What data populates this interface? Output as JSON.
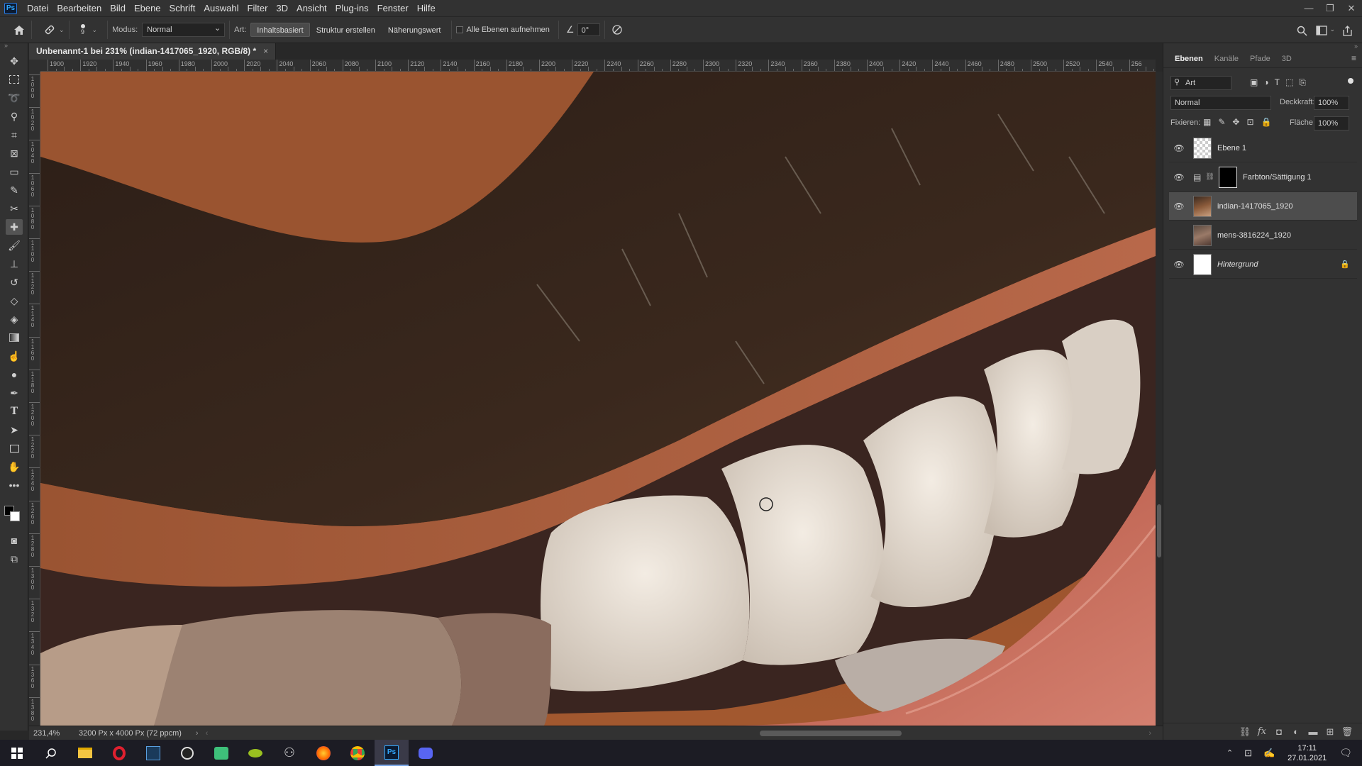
{
  "app": {
    "logo": "Ps",
    "menu": [
      "Datei",
      "Bearbeiten",
      "Bild",
      "Ebene",
      "Schrift",
      "Auswahl",
      "Filter",
      "3D",
      "Ansicht",
      "Plug-ins",
      "Fenster",
      "Hilfe"
    ],
    "window_controls": [
      "—",
      "❐",
      "✕"
    ]
  },
  "options": {
    "brush_size": "9",
    "mode_label": "Modus:",
    "mode_value": "Normal",
    "type_label": "Art:",
    "type_buttons": [
      "Inhaltsbasiert",
      "Struktur erstellen",
      "Näherungswert"
    ],
    "sample_all_label": "Alle Ebenen aufnehmen",
    "angle_value": "0°"
  },
  "document": {
    "tab_title": "Unbenannt-1 bei 231% (indian-1417065_1920, RGB/8) *",
    "close": "×",
    "ruler_labels": [
      "1900",
      "1920",
      "1940",
      "1960",
      "1980",
      "2000",
      "2020",
      "2040",
      "2060",
      "2080",
      "2100",
      "2120",
      "2140",
      "2160",
      "2180",
      "2200",
      "2220",
      "2240",
      "2260",
      "2280",
      "2300",
      "2320",
      "2340",
      "2360",
      "2380",
      "2400",
      "2420",
      "2440",
      "2460",
      "2480",
      "2500",
      "2520",
      "2540",
      "256"
    ],
    "vertical_ruler_labels": [
      "1000",
      "1020",
      "1040",
      "1060",
      "1080",
      "1100",
      "1120",
      "1140",
      "1160",
      "1180",
      "1200",
      "1220",
      "1240",
      "1260",
      "1280",
      "1300",
      "1320",
      "1340",
      "1360",
      "1380"
    ]
  },
  "status": {
    "zoom": "231,4%",
    "doc_size": "3200 Px x 4000 Px (72 ppcm)"
  },
  "panel": {
    "tabs": [
      "Ebenen",
      "Kanäle",
      "Pfade",
      "3D"
    ],
    "filter_value": "Art",
    "blend_mode": "Normal",
    "opacity_label": "Deckkraft:",
    "opacity_value": "100%",
    "lock_label": "Fixieren:",
    "fill_label": "Fläche:",
    "fill_value": "100%",
    "layers": [
      {
        "name": "Ebene 1",
        "visible": true,
        "selected": false,
        "thumb": "transparent"
      },
      {
        "name": "Farbton/Sättigung 1",
        "visible": true,
        "selected": false,
        "thumb": "adjustment"
      },
      {
        "name": "indian-1417065_1920",
        "visible": true,
        "selected": true,
        "thumb": "photo"
      },
      {
        "name": "mens-3816224_1920",
        "visible": false,
        "selected": false,
        "thumb": "photo2"
      },
      {
        "name": "Hintergrund",
        "visible": true,
        "selected": false,
        "thumb": "white",
        "locked": true
      }
    ]
  },
  "taskbar": {
    "time": "17:11",
    "date": "27.01.2021"
  },
  "colors": {
    "accent": "#31a8ff",
    "panel_bg": "#323232",
    "selected_layer": "#4d4d4d"
  }
}
